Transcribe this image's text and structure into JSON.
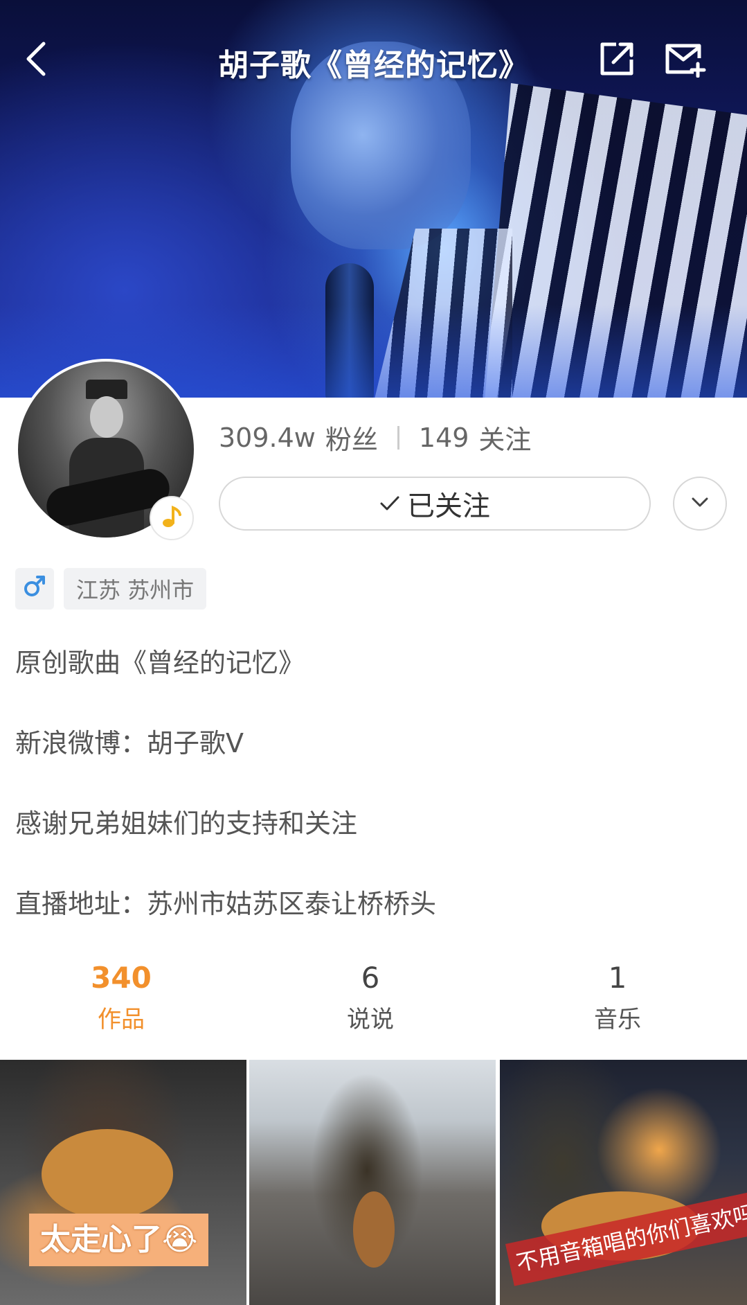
{
  "header": {
    "title": "胡子歌《曾经的记忆》",
    "icons": [
      "back-arrow-icon",
      "share-icon",
      "message-add-icon"
    ]
  },
  "profile": {
    "fans_count": "309.4w",
    "fans_label": "粉丝",
    "following_count": "149",
    "following_label": "关注",
    "follow_button_label": "已关注",
    "gender": "male",
    "gender_symbol": "♂",
    "location": "江苏 苏州市",
    "badge_icon": "music-note-icon",
    "bio": [
      "原创歌曲《曾经的记忆》",
      "新浪微博：胡子歌V",
      "感谢兄弟姐妹们的支持和关注",
      "直播地址：苏州市姑苏区泰让桥桥头"
    ]
  },
  "counts": [
    {
      "num": "340",
      "label": "作品",
      "active": true
    },
    {
      "num": "6",
      "label": "说说",
      "active": false
    },
    {
      "num": "1",
      "label": "音乐",
      "active": false
    }
  ],
  "thumbnails": [
    {
      "caption": "太走心了😭"
    },
    {
      "caption": ""
    },
    {
      "caption": "不用音箱唱的你们喜欢吗"
    }
  ],
  "colors": {
    "accent": "#f2902c",
    "text_secondary": "#666666",
    "border": "#d7d7d7"
  }
}
